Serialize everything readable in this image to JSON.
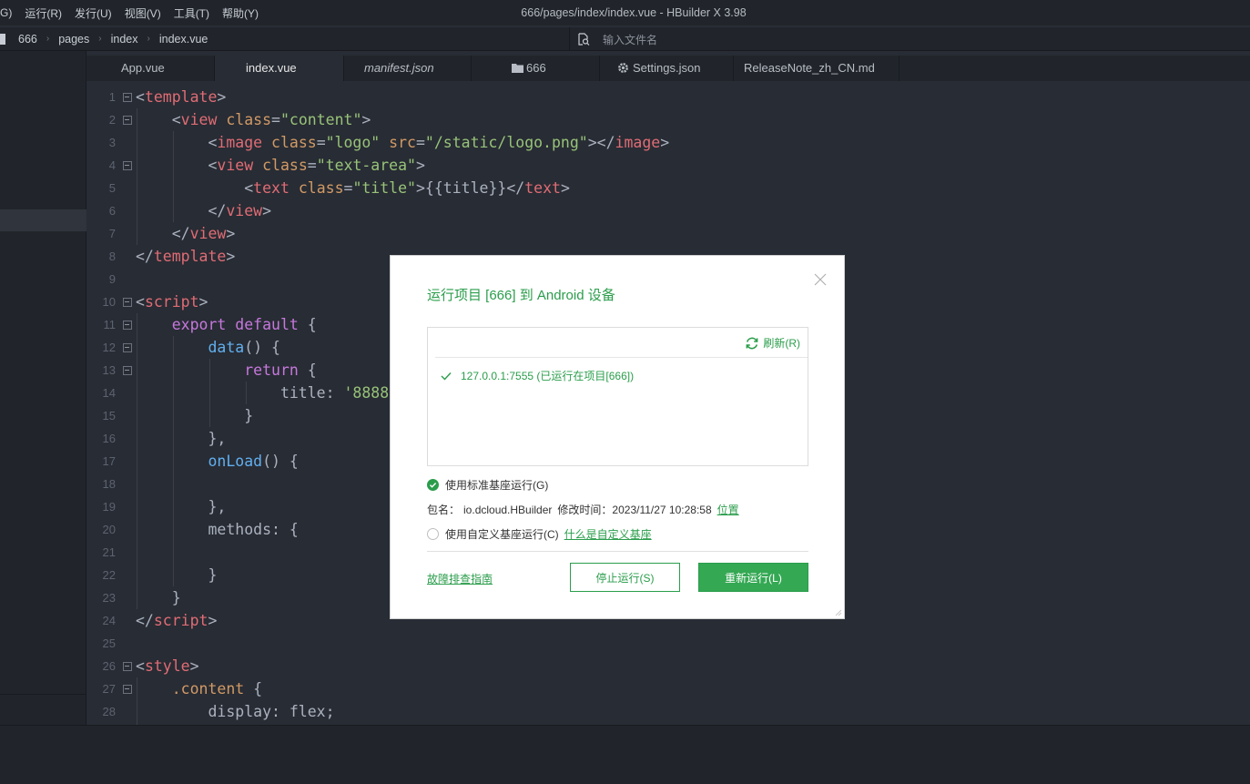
{
  "window": {
    "title": "666/pages/index/index.vue - HBuilder X 3.98"
  },
  "menu": [
    "G)",
    "运行(R)",
    "发行(U)",
    "视图(V)",
    "工具(T)",
    "帮助(Y)"
  ],
  "breadcrumb": [
    "666",
    "pages",
    "index",
    "index.vue"
  ],
  "file_search": {
    "placeholder": "输入文件名"
  },
  "tabs": [
    {
      "label": "App.vue"
    },
    {
      "label": "index.vue"
    },
    {
      "label": "manifest.json"
    },
    {
      "label": "666"
    },
    {
      "label": "Settings.json"
    },
    {
      "label": "ReleaseNote_zh_CN.md"
    }
  ],
  "line_numbers": [
    "1",
    "2",
    "3",
    "4",
    "5",
    "6",
    "7",
    "8",
    "9",
    "10",
    "11",
    "12",
    "13",
    "14",
    "15",
    "16",
    "17",
    "18",
    "19",
    "20",
    "21",
    "22",
    "23",
    "24",
    "25",
    "26",
    "27",
    "28"
  ],
  "dialog": {
    "title": "运行项目 [666] 到 Android 设备",
    "refresh_label": "刷新(R)",
    "device": "127.0.0.1:7555 (已运行在项目[666])",
    "opt_standard": "使用标准基座运行(G)",
    "package_label": "包名：",
    "package_name": "io.dcloud.HBuilder",
    "modified_label": "修改时间：",
    "modified_time": "2023/11/27 10:28:58",
    "location_link": "位置",
    "opt_custom": "使用自定义基座运行(C)",
    "custom_help_link": "什么是自定义基座",
    "troubleshoot_link": "故障排查指南",
    "stop_button": "停止运行(S)",
    "rerun_button": "重新运行(L)"
  },
  "colors": {
    "accent": "#2a9d4b",
    "editor_bg": "#282c34",
    "panel_bg": "#21252b"
  }
}
